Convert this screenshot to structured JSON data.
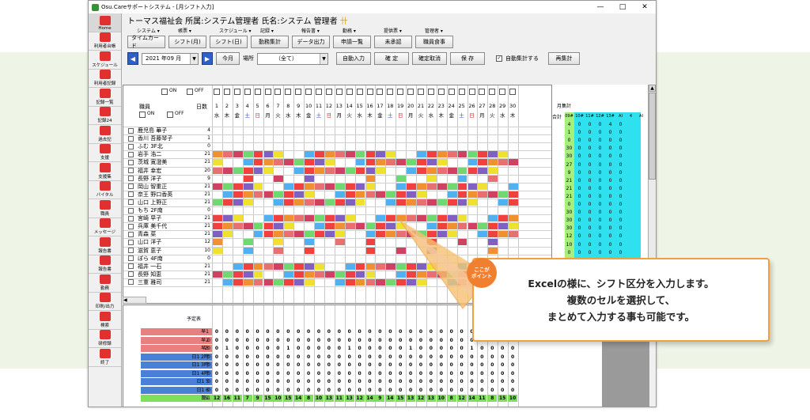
{
  "window": {
    "title": "Osu.Careサポートシステム - [月シフト入力]",
    "controls": [
      "—",
      "□",
      "✕"
    ]
  },
  "header": {
    "text": "トーマス福祉会 所属:システム管理者 氏名:システム 管理者",
    "mark": "卄"
  },
  "menu": [
    "システム ▾",
    "帳票 ▾",
    "スケジュール ▾",
    "記録 ▾",
    "報告書 ▾",
    "勤務 ▾",
    "提供票 ▾",
    "管理者 ▾"
  ],
  "sidebar": [
    {
      "label": "Home",
      "color": "#e03030"
    },
    {
      "label": "利用者台帳",
      "color": "#e03030"
    },
    {
      "label": "スケジュール",
      "color": "#e03030"
    },
    {
      "label": "利用者記録",
      "color": "#e03030"
    },
    {
      "label": "記録一覧",
      "color": "#e03030"
    },
    {
      "label": "記録24",
      "color": "#e03030"
    },
    {
      "label": "過去記",
      "color": "#e03030"
    },
    {
      "label": "支援",
      "color": "#e03030"
    },
    {
      "label": "支援集",
      "color": "#e03030"
    },
    {
      "label": "バイタル",
      "color": "#e03030"
    },
    {
      "label": "職員",
      "color": "#e03030"
    },
    {
      "label": "メッセージ",
      "color": "#e03030"
    },
    {
      "label": "報告書",
      "color": "#e03030"
    },
    {
      "label": "報告書",
      "color": "#e03030"
    },
    {
      "label": "勤務",
      "color": "#e03030"
    },
    {
      "label": "印刷/出力",
      "color": "#e03030"
    },
    {
      "label": "検索",
      "color": "#e03030"
    },
    {
      "label": "研修録",
      "color": "#e03030"
    },
    {
      "label": "終了",
      "color": "#e03030"
    }
  ],
  "toolbar": [
    "タイムカード",
    "シフト(月)",
    "シフト(日)",
    "勤務集計",
    "データ出力",
    "申請一覧",
    "未承認",
    "職員食事"
  ],
  "controls": {
    "month": "2021 年09 月",
    "today": "今月",
    "place_label": "場所",
    "place_value": "（全て）",
    "auto_input": "自動入力",
    "confirm": "確 定",
    "cancel_confirm": "確定取消",
    "save": "保 存",
    "auto_calc": "自動集計する",
    "recalc": "再集計"
  },
  "grid": {
    "on_label": "ON",
    "off_label": "OFF",
    "name_header": "職員",
    "days_header": "日数",
    "month_total": "月集計",
    "total_label": "合計",
    "days": [
      "1",
      "2",
      "3",
      "4",
      "5",
      "6",
      "7",
      "8",
      "9",
      "10",
      "11",
      "12",
      "13",
      "14",
      "15",
      "16",
      "17",
      "18",
      "19",
      "20",
      "21",
      "22",
      "23",
      "24",
      "25",
      "26",
      "27",
      "28",
      "29",
      "30"
    ],
    "weekdays": [
      "水",
      "木",
      "金",
      "土",
      "日",
      "月",
      "火",
      "水",
      "木",
      "金",
      "土",
      "日",
      "月",
      "火",
      "水",
      "木",
      "金",
      "土",
      "日",
      "月",
      "火",
      "水",
      "木",
      "金",
      "土",
      "日",
      "月",
      "火",
      "水",
      "木"
    ],
    "summary_cols": [
      "09#",
      "10#",
      "11#",
      "12#",
      "13#",
      "AI",
      "4",
      "AI"
    ],
    "rows": [
      {
        "name": "鹿児島 華子",
        "days": "4",
        "totals": [
          "4",
          "0",
          "0",
          "0",
          "4",
          "0"
        ]
      },
      {
        "name": "香川 吾藤琴子",
        "days": "1",
        "totals": [
          "1",
          "0",
          "0",
          "0",
          "0",
          "0"
        ]
      },
      {
        "name": "ふむ 3F北",
        "days": "0",
        "totals": [
          "0",
          "0",
          "0",
          "0",
          "0",
          "0"
        ]
      },
      {
        "name": "岩手 浩二",
        "days": "21",
        "totals": [
          "30",
          "0",
          "0",
          "0",
          "0",
          "0"
        ]
      },
      {
        "name": "茨城 寛澄美",
        "days": "21",
        "totals": [
          "30",
          "0",
          "0",
          "0",
          "0",
          "0"
        ]
      },
      {
        "name": "福井 幸宏",
        "days": "20",
        "totals": [
          "27",
          "0",
          "0",
          "0",
          "0",
          "0"
        ]
      },
      {
        "name": "長野 洋子",
        "days": "9",
        "totals": [
          "9",
          "0",
          "0",
          "0",
          "0",
          "0"
        ]
      },
      {
        "name": "岡山 智重正",
        "days": "21",
        "totals": [
          "21",
          "0",
          "0",
          "0",
          "0",
          "0"
        ]
      },
      {
        "name": "奈王 野口香英",
        "days": "21",
        "totals": [
          "21",
          "0",
          "0",
          "0",
          "0",
          "0"
        ]
      },
      {
        "name": "山口 上野正",
        "days": "21",
        "totals": [
          "21",
          "0",
          "0",
          "0",
          "0",
          "0"
        ]
      },
      {
        "name": "もち 2F南",
        "days": "0",
        "totals": [
          "0",
          "0",
          "0",
          "0",
          "0",
          "0"
        ]
      },
      {
        "name": "宮崎 早子",
        "days": "21",
        "totals": [
          "30",
          "0",
          "0",
          "0",
          "0",
          "0"
        ]
      },
      {
        "name": "兵庫 美千代",
        "days": "21",
        "totals": [
          "30",
          "0",
          "0",
          "0",
          "0",
          "0"
        ]
      },
      {
        "name": "青森 菜",
        "days": "21",
        "totals": [
          "30",
          "0",
          "0",
          "0",
          "0",
          "0"
        ]
      },
      {
        "name": "山口 洋子",
        "days": "12",
        "totals": [
          "12",
          "0",
          "0",
          "0",
          "0",
          "0"
        ]
      },
      {
        "name": "滋賀 恵子",
        "days": "10",
        "totals": [
          "10",
          "0",
          "0",
          "0",
          "0",
          "0"
        ]
      },
      {
        "name": "ぽら 4F南",
        "days": "0",
        "totals": [
          "0",
          "0",
          "0",
          "0",
          "0",
          "0"
        ]
      },
      {
        "name": "福井 一石",
        "days": "21",
        "totals": [
          "",
          "",
          "",
          "",
          "",
          ""
        ]
      },
      {
        "name": "長野 知恵",
        "days": "21",
        "totals": [
          "",
          "",
          "",
          "",
          "",
          ""
        ]
      },
      {
        "name": "三重 雅司",
        "days": "21",
        "totals": [
          "",
          "",
          "",
          "",
          "",
          ""
        ]
      }
    ]
  },
  "bottom": {
    "header": "予定表",
    "rows": [
      {
        "name": "早1",
        "val": "",
        "color": "#e88080"
      },
      {
        "name": "早2",
        "val": "0",
        "color": "#e88080"
      },
      {
        "name": "早3",
        "val": "20",
        "color": "#e88080"
      },
      {
        "name": "日1 2時",
        "val": "0",
        "color": "#4a80d8"
      },
      {
        "name": "日1 3時",
        "val": "0",
        "color": "#4a80d8"
      },
      {
        "name": "日1 4時",
        "val": "0",
        "color": "#4a80d8"
      },
      {
        "name": "日1 5",
        "val": "0",
        "color": "#4a80d8"
      },
      {
        "name": "日1 6",
        "val": "0",
        "color": "#4a80d8"
      },
      {
        "name": "日1",
        "val": "351",
        "color": "#7ee05a"
      }
    ],
    "last_row": [
      "12",
      "16",
      "11",
      "7",
      "9",
      "15",
      "10",
      "15",
      "14",
      "8",
      "10",
      "13",
      "11",
      "13",
      "12",
      "14",
      "9",
      "14",
      "15",
      "13",
      "12",
      "13",
      "10",
      "8",
      "12",
      "14",
      "11",
      "8",
      "15",
      "10"
    ]
  },
  "callout": {
    "badge_line1": "ここが",
    "badge_line2": "ポイント",
    "lines": [
      "Excelの様に、シフト区分を入力します。",
      "複数のセルを選択して、",
      "まとめて入力する事も可能です。"
    ]
  },
  "colors": {
    "cyan": "#2fe0ef",
    "green": "#a6f07a",
    "orange": "#f0a040",
    "blue": "#2f5fc8"
  }
}
